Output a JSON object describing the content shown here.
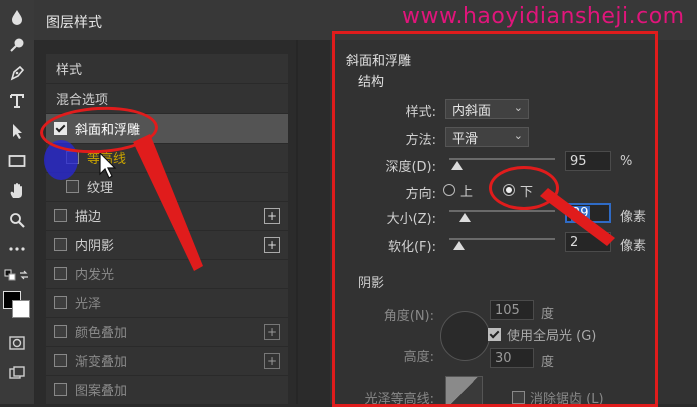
{
  "dialog": {
    "title": "图层样式"
  },
  "watermark": {
    "url": "www.haoyidiansheji.com",
    "color": "#e0157b"
  },
  "tools": [
    {
      "icon": "drop-icon"
    },
    {
      "icon": "dodge-icon"
    },
    {
      "icon": "pen-icon"
    },
    {
      "icon": "type-icon"
    },
    {
      "icon": "path-select-icon"
    },
    {
      "icon": "rectangle-icon"
    },
    {
      "icon": "hand-icon"
    },
    {
      "icon": "zoom-icon"
    },
    {
      "icon": "more-icon"
    },
    {
      "icon": "swap-icon"
    },
    {
      "icon": "quickmask-icon"
    },
    {
      "icon": "screenmode-icon"
    }
  ],
  "styles_list": {
    "header": "样式",
    "blend_options": "混合选项",
    "items": [
      {
        "label": "斜面和浮雕",
        "checked": true,
        "selected": true
      },
      {
        "label": "等高线",
        "checked": false,
        "sub": true
      },
      {
        "label": "纹理",
        "checked": false,
        "sub": true
      },
      {
        "label": "描边",
        "checked": false,
        "plus": true
      },
      {
        "label": "内阴影",
        "checked": false,
        "plus": true
      },
      {
        "label": "内发光",
        "checked": false
      },
      {
        "label": "光泽",
        "checked": false
      },
      {
        "label": "颜色叠加",
        "checked": false,
        "plus": true
      },
      {
        "label": "渐变叠加",
        "checked": false,
        "plus": true
      },
      {
        "label": "图案叠加",
        "checked": false
      }
    ],
    "plus_symbol": "+"
  },
  "bevel": {
    "section_title": "斜面和浮雕",
    "structure_title": "结构",
    "style_label": "样式:",
    "style_value": "内斜面",
    "technique_label": "方法:",
    "technique_value": "平滑",
    "depth_label": "深度(D):",
    "depth_value": "95",
    "depth_unit": "%",
    "direction_label": "方向:",
    "direction_up": "上",
    "direction_down": "下",
    "direction_selected": "下",
    "size_label": "大小(Z):",
    "size_value": "29",
    "size_unit": "像素",
    "soften_label": "软化(F):",
    "soften_value": "2",
    "soften_unit": "像素",
    "shading_title": "阴影",
    "angle_label": "角度(N):",
    "angle_value": "105",
    "angle_unit": "度",
    "global_light_label": "使用全局光 (G)",
    "global_light_checked": true,
    "altitude_label": "高度:",
    "altitude_value": "30",
    "altitude_unit": "度",
    "gloss_contour_label": "光泽等高线:",
    "antialias_label": "消除锯齿 (L)"
  },
  "dropdown_chevron": "⌄"
}
